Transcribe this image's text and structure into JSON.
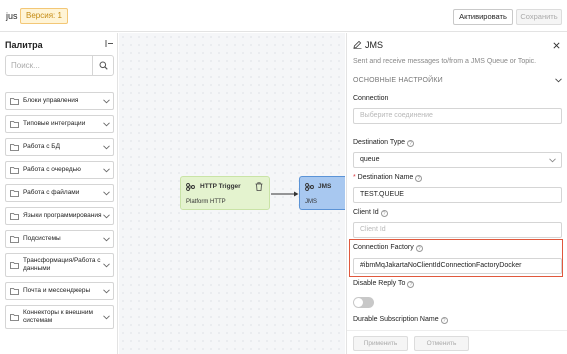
{
  "header": {
    "app_name": "jus",
    "version_badge": "Версия: 1",
    "activate_label": "Активировать",
    "save_label": "Сохранить"
  },
  "palette": {
    "title": "Палитра",
    "search_placeholder": "Поиск...",
    "items": [
      {
        "label": "Блоки управления"
      },
      {
        "label": "Типовые интеграции"
      },
      {
        "label": "Работа с БД"
      },
      {
        "label": "Работа с очередью"
      },
      {
        "label": "Работа с файлами"
      },
      {
        "label": "Языки программирования"
      },
      {
        "label": "Подсистемы"
      },
      {
        "label": "Трансформация/Работа с данными"
      },
      {
        "label": "Почта и мессенджеры"
      },
      {
        "label": "Коннекторы к внешним системам"
      }
    ]
  },
  "canvas": {
    "trigger_node": {
      "title": "HTTP Trigger",
      "subtitle": "Platform HTTP"
    },
    "jms_node": {
      "title": "JMS",
      "subtitle": "JMS"
    }
  },
  "panel": {
    "title": "JMS",
    "description": "Sent and receive messages to/from a JMS Queue or Topic.",
    "section_title": "ОСНОВНЫЕ НАСТРОЙКИ",
    "connection_label": "Connection",
    "connection_placeholder": "Выберите соединение",
    "destination_type_label": "Destination Type",
    "destination_type_value": "queue",
    "destination_name_label": "Destination Name",
    "destination_name_value": "TEST.QUEUE",
    "client_id_label": "Client Id",
    "client_id_placeholder": "Client Id",
    "connection_factory_label": "Connection Factory",
    "connection_factory_value": "#ibmMqJakartaNoClientIdConnectionFactoryDocker",
    "disable_reply_to_label": "Disable Reply To",
    "durable_subscription_label": "Durable Subscription Name",
    "apply_label": "Применить",
    "cancel_label": "Отменить"
  },
  "colors": {
    "accent_highlight": "#e0583d",
    "trigger_node": "#e4f3cf",
    "jms_node": "#a8c8f0",
    "version_badge": "#fff4d6"
  }
}
